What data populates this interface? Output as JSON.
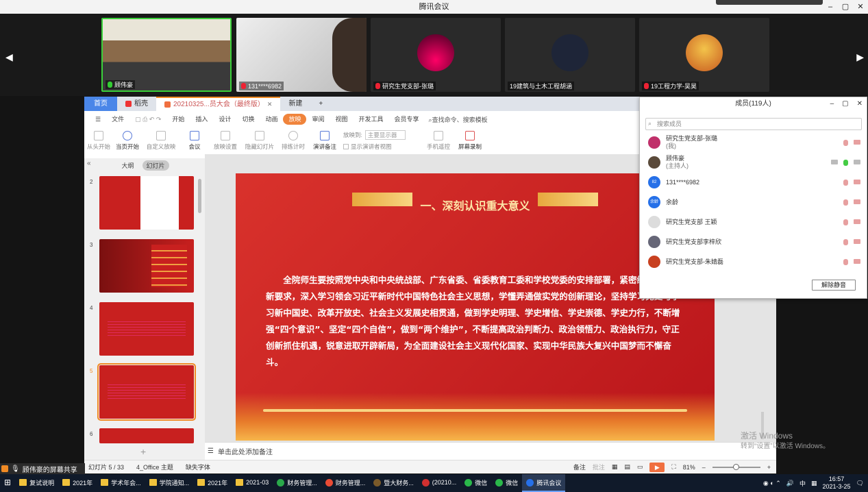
{
  "window": {
    "title": "腾讯会议"
  },
  "videos": [
    {
      "name": "顾伟豪",
      "mic": "on",
      "bg": "#6a5a4a"
    },
    {
      "name": "131****6982",
      "mic": "off",
      "bg": "#d8d8d8"
    },
    {
      "name": "研究生党支部-张璐",
      "mic": "off",
      "avatar": "#c0306a"
    },
    {
      "name": "19建筑与土木工程胡涵",
      "mic": "none",
      "avatar": "#333a55"
    },
    {
      "name": "19工程力学-吴昊",
      "mic": "off",
      "avatar": "#d05030"
    }
  ],
  "wps": {
    "tabs": {
      "home": "首页",
      "daoke": "稻壳",
      "doc": "20210325...员大会（最终版）",
      "new": "新建",
      "plus": "+"
    },
    "menus": [
      "文件",
      "开始",
      "插入",
      "设计",
      "切换",
      "动画",
      "放映",
      "审阅",
      "视图",
      "开发工具",
      "会员专享"
    ],
    "menu_selected": "放映",
    "search_placeholder": "查找命令、搜索模板",
    "toolbar": [
      "从头开始",
      "当页开始",
      "自定义放映",
      "会议",
      "放映设置",
      "隐藏幻灯片",
      "排练计时",
      "演讲备注",
      "放映到:",
      "主要显示器",
      "显示演讲者视图",
      "手机遥控",
      "屏幕录制"
    ],
    "panel_tabs": {
      "outline": "大纲",
      "slides": "幻灯片"
    },
    "thumb_numbers": [
      "2",
      "3",
      "4",
      "5",
      "6"
    ],
    "slide": {
      "title": "一、深刻认识重大意义",
      "body": "全院师生要按照党中央和中央统战部、广东省委、省委教育工委和学校党委的安排部署，紧密结合新时代新要求，深入学习领会习近平新时代中国特色社会主义思想，学懂弄通做实党的创新理论，坚持学习党史与学习新中国史、改革开放史、社会主义发展史相贯通，做到学史明理、学史增信、学史崇德、学史力行，不断增强“四个意识”、坚定“四个自信”，做到“两个维护”，不断提高政治判断力、政治领悟力、政治执行力，守正创新抓住机遇，锐意进取开辟新局，为全面建设社会主义现代化国家、实现中华民族大复兴中国梦而不懈奋斗。"
    },
    "notes_placeholder": "单击此处添加备注",
    "status": {
      "slide": "幻灯片 5 / 33",
      "theme": "4_Office 主题",
      "font": "缺失字体",
      "notes": "备注",
      "comment": "批注",
      "zoom": "81%"
    }
  },
  "members": {
    "title": "成员(119人)",
    "search_placeholder": "搜索成员",
    "list": [
      {
        "name": "研究生党支部-张璐",
        "sub": "(我)",
        "avatar_text": "",
        "color": "#c0306a",
        "mic": "off"
      },
      {
        "name": "顾伟豪",
        "sub": "(主持人)",
        "avatar_text": "",
        "color": "#5a4a3a",
        "mic": "on"
      },
      {
        "name": "131****6982",
        "sub": "",
        "avatar_text": "82",
        "color": "#2670e8",
        "mic": "off"
      },
      {
        "name": "余龄",
        "sub": "",
        "avatar_text": "余龄",
        "color": "#2670e8",
        "mic": "off"
      },
      {
        "name": "研究生党支部 王颖",
        "sub": "",
        "avatar_text": "",
        "color": "#dcdcdc",
        "mic": "off"
      },
      {
        "name": "研究生党支部李梓欣",
        "sub": "",
        "avatar_text": "",
        "color": "#667",
        "mic": "off"
      },
      {
        "name": "研究生党支部-朱婧磊",
        "sub": "",
        "avatar_text": "",
        "color": "#c84020",
        "mic": "off"
      }
    ],
    "unmute_button": "解除静音"
  },
  "share": {
    "label": "顾伟豪的屏幕共享"
  },
  "watermark": {
    "line1": "激活 Windows",
    "line2": "转到“设置”以激活 Windows。"
  },
  "taskbar": {
    "items": [
      {
        "label": "复试说明",
        "type": "folder"
      },
      {
        "label": "2021年",
        "type": "folder"
      },
      {
        "label": "学术年会...",
        "type": "folder"
      },
      {
        "label": "学院通知...",
        "type": "folder"
      },
      {
        "label": "2021年",
        "type": "folder"
      },
      {
        "label": "2021-03",
        "type": "folder"
      },
      {
        "label": "财务管理...",
        "type": "app",
        "color": "#2aa84a"
      },
      {
        "label": "财务管理...",
        "type": "app",
        "color": "#e94b35"
      },
      {
        "label": "暨大财务...",
        "type": "app",
        "color": "#7a5a2a"
      },
      {
        "label": "(20210...",
        "type": "app",
        "color": "#d03030"
      },
      {
        "label": "微信",
        "type": "app",
        "color": "#2ab84a"
      },
      {
        "label": "微信",
        "type": "app",
        "color": "#2ab84a"
      },
      {
        "label": "腾讯会议",
        "type": "app",
        "color": "#2670e8",
        "active": true
      }
    ],
    "ime": "中",
    "time": "16:57",
    "date": "2021-3-25"
  }
}
